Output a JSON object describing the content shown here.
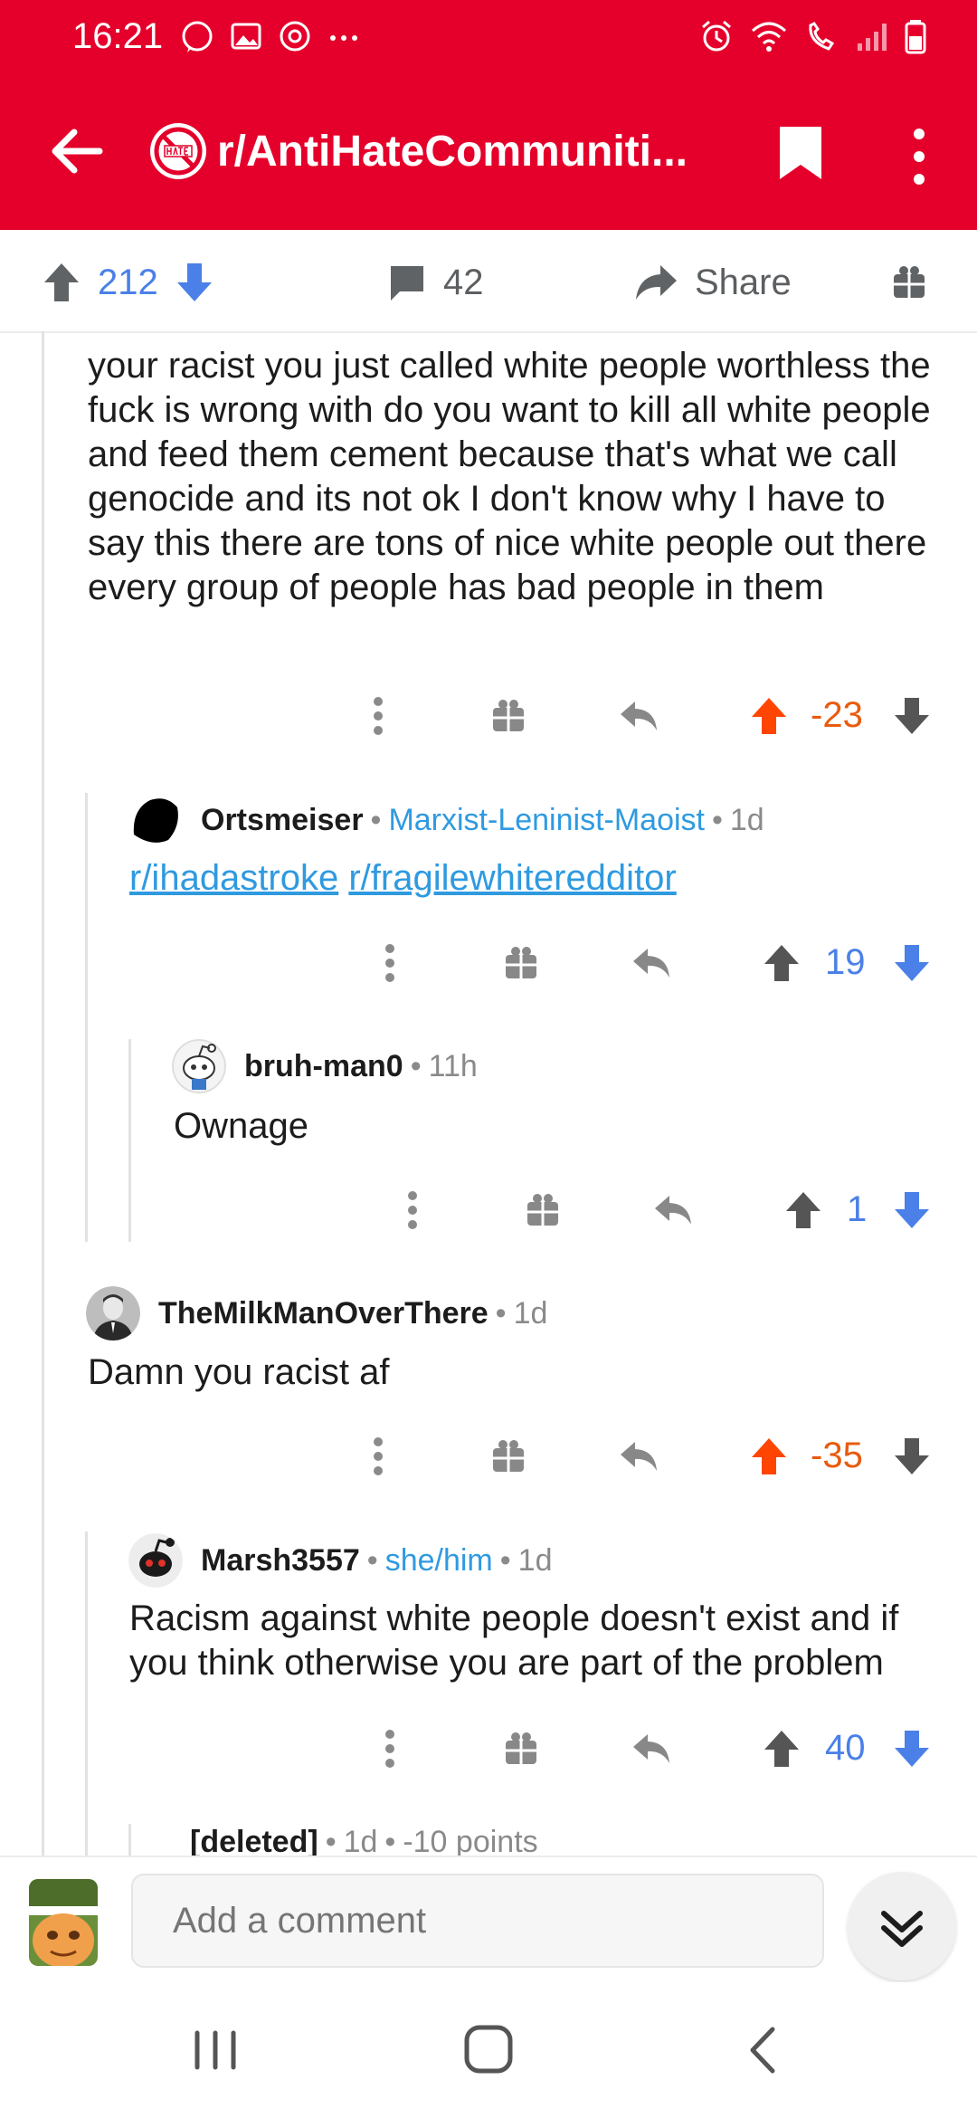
{
  "status_bar": {
    "time": "16:21"
  },
  "app_bar": {
    "subreddit_name": "r/AntiHateCommuniti..."
  },
  "action_bar": {
    "upvote_count": "212",
    "comment_count": "42",
    "share_label": "Share"
  },
  "comments": [
    {
      "id": "c1",
      "body": "your racist you just called white people worthless the fuck is wrong with do you want to kill all white people and feed them cement because that's what we call genocide and its not ok I don't know why I have to say this there are tons of nice white people out there every group of people has bad people in them",
      "score": "-23"
    },
    {
      "id": "c2",
      "author": "Ortsmeiser",
      "flair": "Marxist-Leninist-Maoist",
      "time": "1d",
      "links": [
        "r/ihadastroke",
        "r/fragilewhiteredditor"
      ],
      "score": "19"
    },
    {
      "id": "c3",
      "author": "bruh-man0",
      "time": "11h",
      "body": "Ownage",
      "score": "1"
    },
    {
      "id": "c4",
      "author": "TheMilkManOverThere",
      "time": "1d",
      "body": "Damn you racist af",
      "score": "-35"
    },
    {
      "id": "c5",
      "author": "Marsh3557",
      "flair": "she/him",
      "time": "1d",
      "body": "Racism against white people doesn't exist and if you think otherwise you are part of the problem",
      "score": "40"
    },
    {
      "id": "c6",
      "author": "[deleted]",
      "time": "1d",
      "points": "-10 points"
    }
  ],
  "composer": {
    "placeholder": "Add a comment"
  },
  "colors": {
    "brand_red": "#e4002b",
    "upvote_orange": "#ff4500",
    "score_orange": "#e85b0e",
    "blue": "#4a80e8",
    "flair_blue": "#2f9ae0",
    "grey_icon": "#5c5f61"
  }
}
